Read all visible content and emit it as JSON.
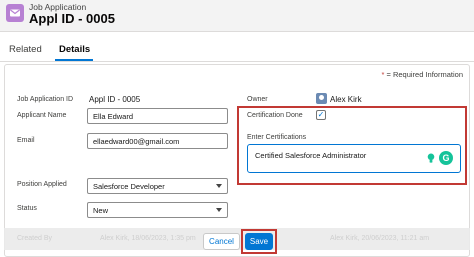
{
  "header": {
    "object_label": "Job Application",
    "record_title": "Appl ID - 0005"
  },
  "tabs": [
    {
      "label": "Related"
    },
    {
      "label": "Details"
    }
  ],
  "form": {
    "required_info": "= Required Information",
    "required_star": "*",
    "job_application_id": {
      "label": "Job Application ID",
      "value": "Appl ID - 0005"
    },
    "applicant_name": {
      "label": "Applicant Name",
      "value": "Ella Edward"
    },
    "email": {
      "label": "Email",
      "value": "ellaedward00@gmail.com"
    },
    "position_applied": {
      "label": "Position Applied",
      "value": "Salesforce Developer"
    },
    "status": {
      "label": "Status",
      "value": "New"
    },
    "owner": {
      "label": "Owner",
      "value": "Alex Kirk"
    },
    "certification_done": {
      "label": "Certification Done",
      "checked": true,
      "check_glyph": "✓"
    },
    "enter_certifications": {
      "label": "Enter Certifications",
      "value": "Certified Salesforce Administrator"
    }
  },
  "faded_row": {
    "created_by_label": "Created By",
    "created_by_value": "Alex Kirk, 18/06/2023, 1:35 pm",
    "modified_by_value": "Alex Kirk, 20/06/2023, 11:21 am"
  },
  "buttons": {
    "cancel": "Cancel",
    "save": "Save"
  },
  "icons": {
    "object_icon": "envelope-icon",
    "owner_avatar": "user-avatar-icon",
    "suggestion": "lightbulb-icon",
    "grammarly": "grammarly-icon",
    "grammarly_glyph": "G"
  },
  "colors": {
    "brand_blue": "#0176d3",
    "highlight_red": "#c23934",
    "object_purple": "#b781d3",
    "grammarly_green": "#15c39a"
  }
}
